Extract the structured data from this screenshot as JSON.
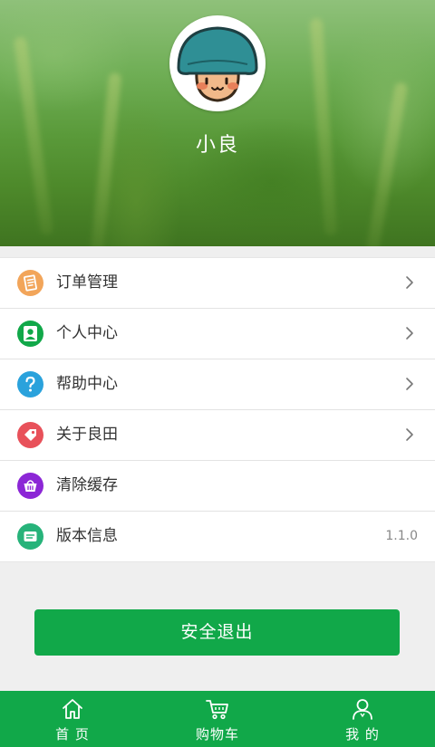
{
  "profile": {
    "username": "小良",
    "avatar_icon": "mushroom-avatar-icon"
  },
  "menu": {
    "items": [
      {
        "label": "订单管理",
        "icon": "order-list-icon",
        "color": "#f2a55a",
        "has_chevron": true
      },
      {
        "label": "个人中心",
        "icon": "person-icon",
        "color": "#11a849",
        "has_chevron": true
      },
      {
        "label": "帮助中心",
        "icon": "question-icon",
        "color": "#2aa2dc",
        "has_chevron": true
      },
      {
        "label": "关于良田",
        "icon": "tag-icon",
        "color": "#e8515a",
        "has_chevron": true
      },
      {
        "label": "清除缓存",
        "icon": "basket-icon",
        "color": "#8c27d6",
        "has_chevron": false
      },
      {
        "label": "版本信息",
        "icon": "info-card-icon",
        "color": "#27b37a",
        "has_chevron": false
      }
    ],
    "version_value": "1.1.0"
  },
  "logout": {
    "label": "安全退出"
  },
  "tabbar": {
    "tabs": [
      {
        "label": "首 页",
        "icon": "home-icon"
      },
      {
        "label": "购物车",
        "icon": "cart-icon"
      },
      {
        "label": "我 的",
        "icon": "user-icon"
      }
    ]
  },
  "colors": {
    "brand_green": "#11a849",
    "page_background": "#efefef"
  }
}
